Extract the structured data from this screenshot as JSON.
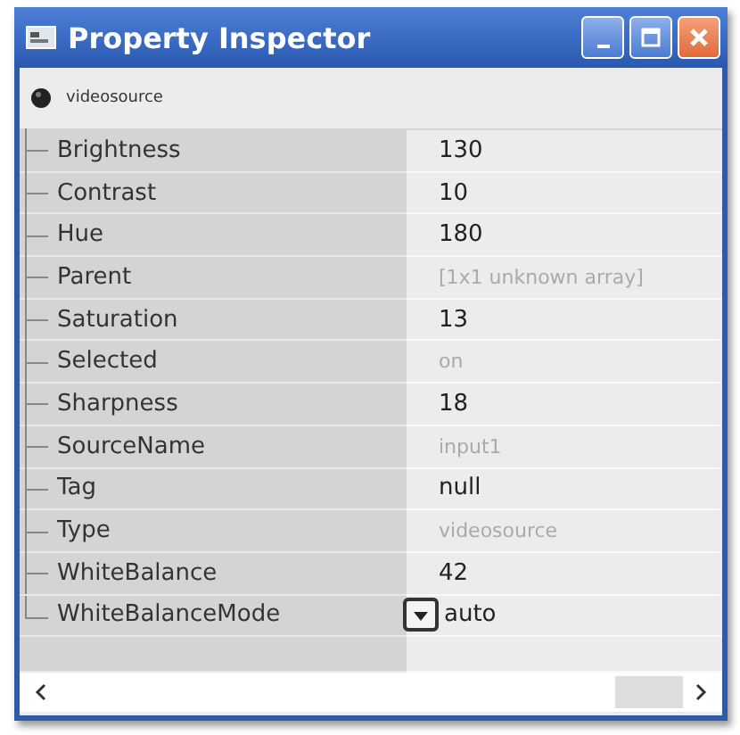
{
  "window": {
    "title": "Property Inspector"
  },
  "object": {
    "name": "videosource"
  },
  "properties": [
    {
      "name": "Brightness",
      "value": "130",
      "disabled": false,
      "kind": "text"
    },
    {
      "name": "Contrast",
      "value": "10",
      "disabled": false,
      "kind": "text"
    },
    {
      "name": "Hue",
      "value": "180",
      "disabled": false,
      "kind": "text"
    },
    {
      "name": "Parent",
      "value": "[1x1  unknown array]",
      "disabled": true,
      "kind": "text"
    },
    {
      "name": "Saturation",
      "value": "13",
      "disabled": false,
      "kind": "text"
    },
    {
      "name": "Selected",
      "value": "on",
      "disabled": true,
      "kind": "text"
    },
    {
      "name": "Sharpness",
      "value": "18",
      "disabled": false,
      "kind": "text"
    },
    {
      "name": "SourceName",
      "value": "input1",
      "disabled": true,
      "kind": "text"
    },
    {
      "name": "Tag",
      "value": "null",
      "disabled": false,
      "kind": "text"
    },
    {
      "name": "Type",
      "value": "videosource",
      "disabled": true,
      "kind": "text"
    },
    {
      "name": "WhiteBalance",
      "value": "42",
      "disabled": false,
      "kind": "text"
    },
    {
      "name": "WhiteBalanceMode",
      "value": "auto",
      "disabled": false,
      "kind": "dropdown"
    }
  ]
}
